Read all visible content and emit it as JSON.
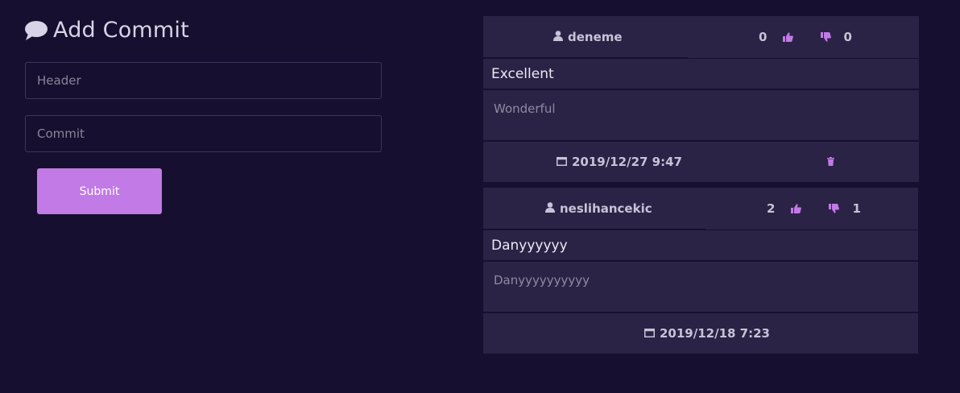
{
  "form": {
    "title": "Add Commit",
    "header_placeholder": "Header",
    "commit_placeholder": "Commit",
    "submit_label": "Submit"
  },
  "comments": [
    {
      "user": "deneme",
      "likes": "0",
      "dislikes": "0",
      "header": "Excellent",
      "body": "Wonderful",
      "date": "2019/12/27 9:47",
      "deletable": true
    },
    {
      "user": "neslihancekic",
      "likes": "2",
      "dislikes": "1",
      "header": "Danyyyyyy",
      "body": "Danyyyyyyyyyy",
      "date": "2019/12/18 7:23",
      "deletable": false
    }
  ],
  "icons": {
    "title": "comment-bubble-icon",
    "user": "user-icon",
    "like": "thumbs-up-icon",
    "dislike": "thumbs-down-icon",
    "date": "calendar-icon",
    "delete": "trash-icon"
  },
  "colors": {
    "background": "#160f2f",
    "card": "#2b2345",
    "accent": "#c17ae6",
    "text": "#d9d4e6",
    "muted": "#8e8aa0"
  }
}
